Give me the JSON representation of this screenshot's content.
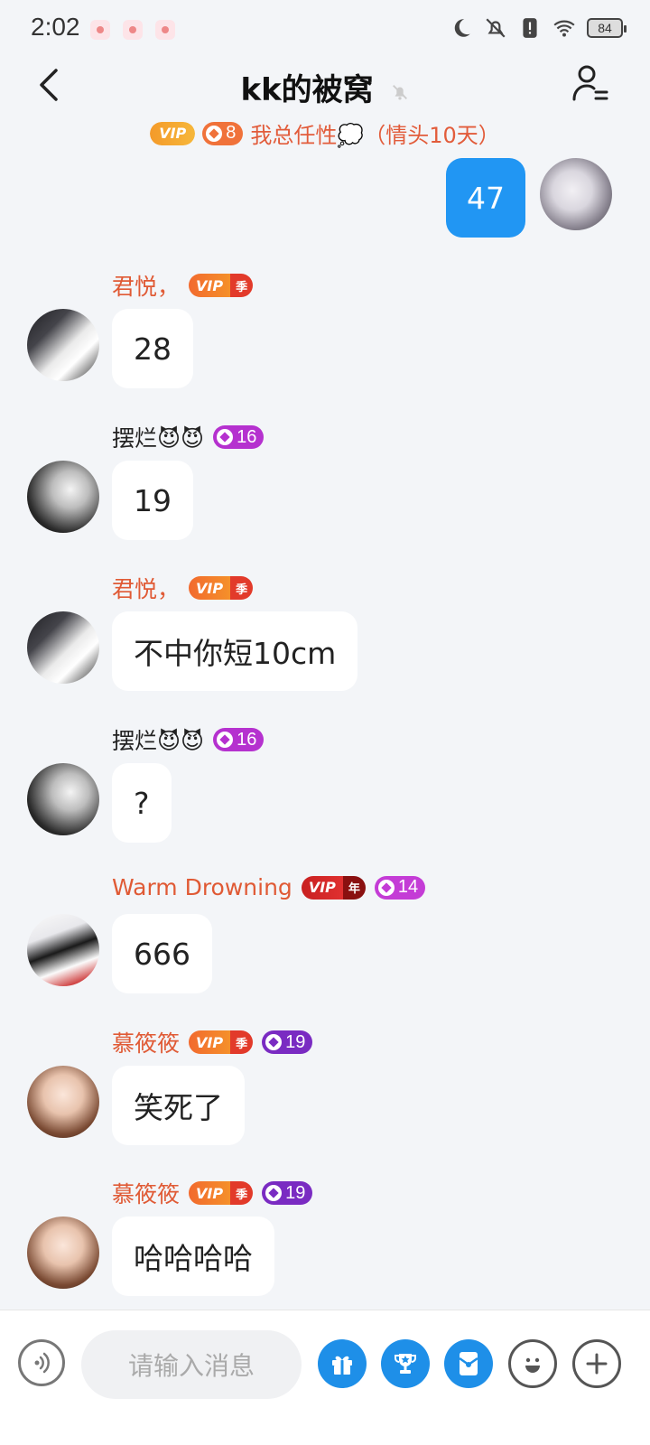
{
  "status_bar": {
    "time": "2:02",
    "battery": "84"
  },
  "header": {
    "title": "kk的被窝",
    "subtitle_text": "我总任性💭（情头10天）",
    "subtitle_level": "8",
    "subtitle_vip": "VIP"
  },
  "self_message": {
    "text": "47"
  },
  "messages": [
    {
      "sender": "君悦，",
      "vip": "VIP",
      "vip_tier": "季",
      "level": null,
      "text": "28"
    },
    {
      "sender": "摆烂😈😈",
      "vip": null,
      "level": "16",
      "text": "19"
    },
    {
      "sender": "君悦，",
      "vip": "VIP",
      "vip_tier": "季",
      "level": null,
      "text": "不中你短10cm"
    },
    {
      "sender": "摆烂😈😈",
      "vip": null,
      "level": "16",
      "text": "?"
    },
    {
      "sender": "Warm Drowning",
      "vip": "VIP",
      "vip_tier": "年",
      "level": "14",
      "text": "666"
    },
    {
      "sender": "慕筱筱",
      "vip": "VIP",
      "vip_tier": "季",
      "level": "19",
      "text": "笑死了"
    },
    {
      "sender": "慕筱筱",
      "vip": "VIP",
      "vip_tier": "季",
      "level": "19",
      "text": "哈哈哈哈"
    }
  ],
  "input": {
    "placeholder": "请输入消息"
  },
  "icons": {
    "back": "chevron-left-icon",
    "mute": "bell-off-icon",
    "members": "user-list-icon",
    "voice": "voice-icon",
    "gift": "gift-icon",
    "trophy": "trophy-icon",
    "redpacket": "red-packet-icon",
    "emoji": "emoji-icon",
    "plus": "plus-icon"
  },
  "colors": {
    "accent_blue": "#2196f3",
    "name_red": "#e05a35",
    "background": "#f3f5f8"
  }
}
